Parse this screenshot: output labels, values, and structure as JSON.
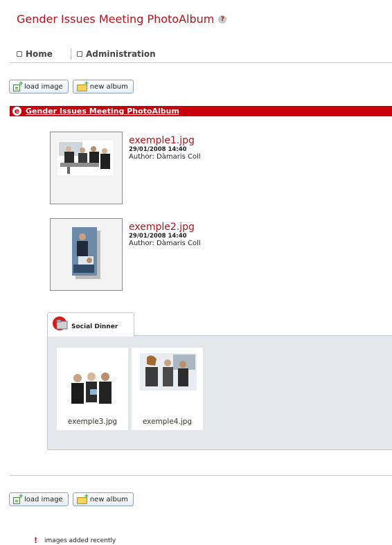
{
  "page": {
    "title": "Gender Issues Meeting PhotoAlbum",
    "help_icon": "?"
  },
  "nav": {
    "items": [
      {
        "label": "Home",
        "icon": "square-bullet-icon"
      },
      {
        "label": "Administration",
        "icon": "square-bullet-icon"
      }
    ]
  },
  "toolbar": {
    "load_image_label": "load image",
    "new_album_label": "new album"
  },
  "album": {
    "title": "Gender Issues Meeting PhotoAlbum",
    "icon_letter": "e",
    "images": [
      {
        "name": "exemple1.jpg",
        "date": "29/01/2008 14:40",
        "author": "Author: Dàmaris Coll"
      },
      {
        "name": "exemple2.jpg",
        "date": "29/01/2008 14:40",
        "author": "Author: Dàmaris Coll"
      }
    ],
    "subalbum": {
      "name": "Social Dinner",
      "images": [
        {
          "name": "exemple3.jpg"
        },
        {
          "name": "exemple4.jpg"
        }
      ]
    }
  },
  "footer": {
    "recent_label": "images added recently",
    "recent_icon": "!"
  },
  "colors": {
    "accent_red": "#c7000b",
    "title_red": "#b3121c",
    "panel_grey": "#e4e7eb"
  }
}
